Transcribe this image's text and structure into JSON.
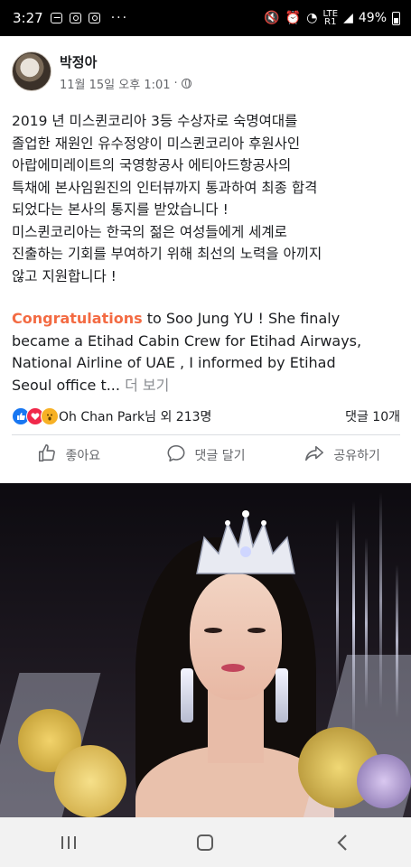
{
  "status_bar": {
    "time": "3:27",
    "notification_icons": [
      "image-icon",
      "instagram-icon",
      "instagram-icon"
    ],
    "overflow": "···",
    "network": "LTE",
    "network_sub": "R1",
    "battery": "49%"
  },
  "post": {
    "author": "박정아",
    "timestamp": "11월 15일 오후 1:01",
    "privacy_icon": "globe-icon",
    "korean_lines": [
      "2019 년 미스퀸코리아 3등 수상자로  숙명여대를",
      "졸업한 재원인 유수정양이 미스퀸코리아 후원사인",
      "아랍에미레이트의 국영항공사 에티아드항공사의",
      "특채에 본사임원진의 인터뷰까지 통과하여 최종 합격",
      "되었다는 본사의 통지를 받았습니다 !",
      "미스퀸코리아는 한국의 젊은 여성들에게 세계로",
      "진출하는 기회를 부여하기 위해 최선의 노력을 아끼지",
      "않고 지원합니다 !"
    ],
    "english_highlight": "Congratulations",
    "english_line1_rest": " to Soo Jung YU ! She finaly",
    "english_line2": "became a Etihad  Cabin Crew for Etihad Airways,",
    "english_line3": "National Airline of UAE , I informed by Etihad",
    "english_line4": "Seoul office t...",
    "see_more": "더 보기"
  },
  "reactions": {
    "icons": [
      "like-icon",
      "love-icon",
      "wow-icon"
    ],
    "summary": "Oh Chan Park님 외 213명",
    "comments": "댓글 10개"
  },
  "actions": {
    "like": "좋아요",
    "comment": "댓글 달기",
    "share": "공유하기"
  },
  "nav": {
    "icons": [
      "recent-apps-icon",
      "home-icon",
      "back-icon"
    ]
  },
  "colors": {
    "highlight": "#f36b43",
    "like": "#1877f2",
    "love": "#f0284a",
    "wow": "#f7b125",
    "secondary_text": "#65676b"
  }
}
